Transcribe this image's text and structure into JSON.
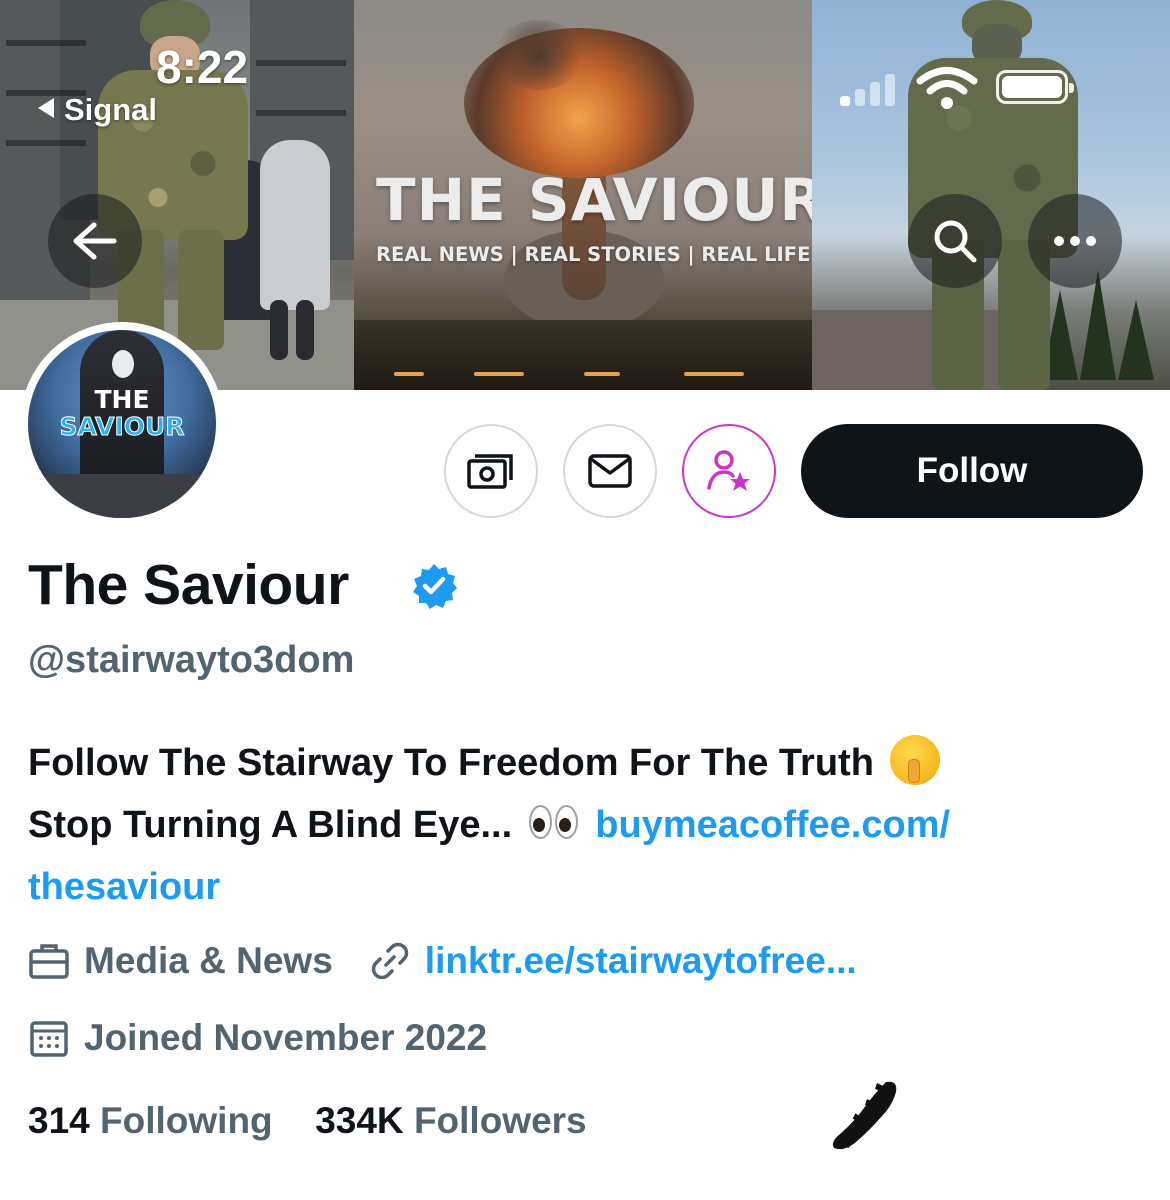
{
  "status_bar": {
    "time": "8:22",
    "back_app": "Signal"
  },
  "banner": {
    "title": "THE SAVIOUR",
    "tagline": "REAL NEWS | REAL STORIES | REAL LIFE",
    "icons": [
      "back-arrow-icon",
      "search-icon",
      "more-icon"
    ]
  },
  "avatar": {
    "line1": "THE",
    "line2": "SAVIOUR"
  },
  "actions": {
    "icons": [
      "tip-money-icon",
      "message-icon",
      "subscribe-icon"
    ],
    "follow_label": "Follow",
    "subscribe_color": "#c936c9"
  },
  "profile": {
    "display_name": "The Saviour",
    "verified": true,
    "handle": "@stairwayto3dom",
    "bio_line1": "Follow The Stairway To Freedom For The Truth",
    "bio_line2": "Stop Turning A Blind Eye...",
    "bio_link_part1": "buymeacoffee.com/",
    "bio_link_part2": "thesaviour",
    "category": "Media & News",
    "website": "linktr.ee/stairwaytofree...",
    "joined": "Joined November 2022"
  },
  "stats": {
    "following_count": "314",
    "following_label": "Following",
    "followers_count": "334K",
    "followers_label": "Followers"
  },
  "colors": {
    "accent": "#1d9bf0",
    "text_primary": "#0f1419",
    "text_secondary": "#536471",
    "follow_bg": "#0f1419"
  }
}
